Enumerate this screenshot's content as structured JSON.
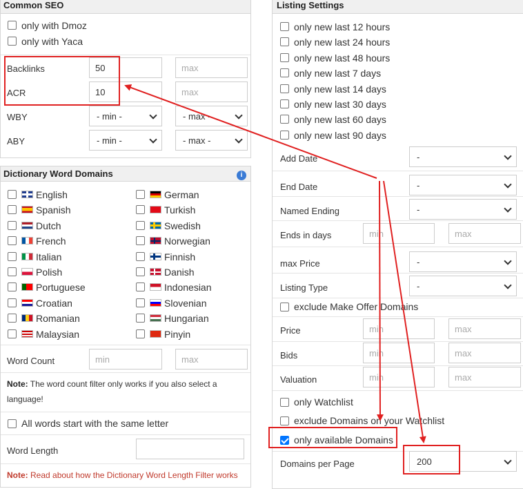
{
  "common_seo": {
    "title": "Common SEO",
    "checkboxes": [
      "only with Dmoz",
      "only with Yaca"
    ],
    "backlinks": {
      "label": "Backlinks",
      "min_value": "50",
      "max_placeholder": "max"
    },
    "acr": {
      "label": "ACR",
      "min_value": "10",
      "max_placeholder": "max"
    },
    "wby": {
      "label": "WBY",
      "min": "- min -",
      "max": "- max -"
    },
    "aby": {
      "label": "ABY",
      "min": "- min -",
      "max": "- max -"
    }
  },
  "dictionary": {
    "title": "Dictionary Word Domains",
    "languages_left": [
      "English",
      "Spanish",
      "Dutch",
      "French",
      "Italian",
      "Polish",
      "Portuguese",
      "Croatian",
      "Romanian",
      "Malaysian"
    ],
    "languages_right": [
      "German",
      "Turkish",
      "Swedish",
      "Norwegian",
      "Finnish",
      "Danish",
      "Indonesian",
      "Slovenian",
      "Hungarian",
      "Pinyin"
    ],
    "word_count": {
      "label": "Word Count",
      "min_placeholder": "min",
      "max_placeholder": "max"
    },
    "note_label": "Note:",
    "note_text": "The word count filter only works if you also select a language!",
    "same_letter": "All words start with the same letter",
    "word_length": {
      "label": "Word Length"
    },
    "note2_label": "Note:",
    "note2_link": "Read about how the Dictionary Word Length Filter works"
  },
  "listing": {
    "title": "Listing Settings",
    "time_checkboxes": [
      "only new last 12 hours",
      "only new last 24 hours",
      "only new last 48 hours",
      "only new last 7 days",
      "only new last 14 days",
      "only new last 30 days",
      "only new last 60 days",
      "only new last 90 days"
    ],
    "add_date": {
      "label": "Add Date",
      "value": "-"
    },
    "end_date": {
      "label": "End Date",
      "value": "-"
    },
    "named_ending": {
      "label": "Named Ending",
      "value": "-"
    },
    "ends_in_days": {
      "label": "Ends in days",
      "min_placeholder": "min",
      "max_placeholder": "max"
    },
    "max_price": {
      "label": "max Price",
      "value": "-"
    },
    "listing_type": {
      "label": "Listing Type",
      "value": "-"
    },
    "exclude_make_offer": "exclude Make Offer Domains",
    "price": {
      "label": "Price",
      "min_placeholder": "min",
      "max_placeholder": "max"
    },
    "bids": {
      "label": "Bids",
      "min_placeholder": "min",
      "max_placeholder": "max"
    },
    "valuation": {
      "label": "Valuation",
      "min_placeholder": "min",
      "max_placeholder": "max"
    },
    "only_watchlist": "only Watchlist",
    "exclude_watchlist": "exclude Domains on your Watchlist",
    "only_available": "only available Domains",
    "only_available_checked": true,
    "domains_per_page": {
      "label": "Domains per Page",
      "value": "200"
    }
  },
  "colors": {
    "annotation": "#e02020",
    "checkbox_checked": "#0075ff",
    "header_bg": "#f0f0f0"
  }
}
